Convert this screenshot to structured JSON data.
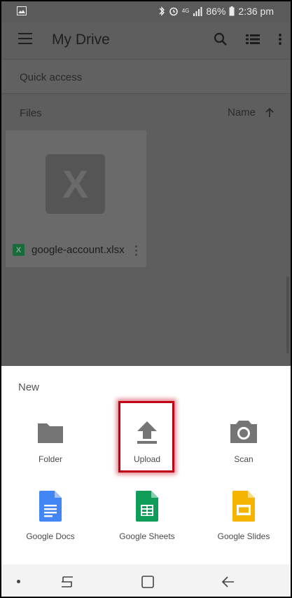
{
  "status_bar": {
    "battery": "86%",
    "time": "2:36 pm",
    "network": "4G"
  },
  "toolbar": {
    "title": "My Drive"
  },
  "quick_access": {
    "label": "Quick access"
  },
  "files": {
    "label": "Files",
    "sort_label": "Name"
  },
  "file_card": {
    "name": "google-account.xlsx",
    "thumb_letter": "X",
    "badge": "X"
  },
  "sheet": {
    "title": "New",
    "options": [
      {
        "label": "Folder"
      },
      {
        "label": "Upload"
      },
      {
        "label": "Scan"
      },
      {
        "label": "Google Docs"
      },
      {
        "label": "Google Sheets"
      },
      {
        "label": "Google Slides"
      }
    ]
  },
  "colors": {
    "docs": "#4285f4",
    "sheets": "#0f9d58",
    "slides": "#f4b400",
    "highlight": "#c00014"
  }
}
